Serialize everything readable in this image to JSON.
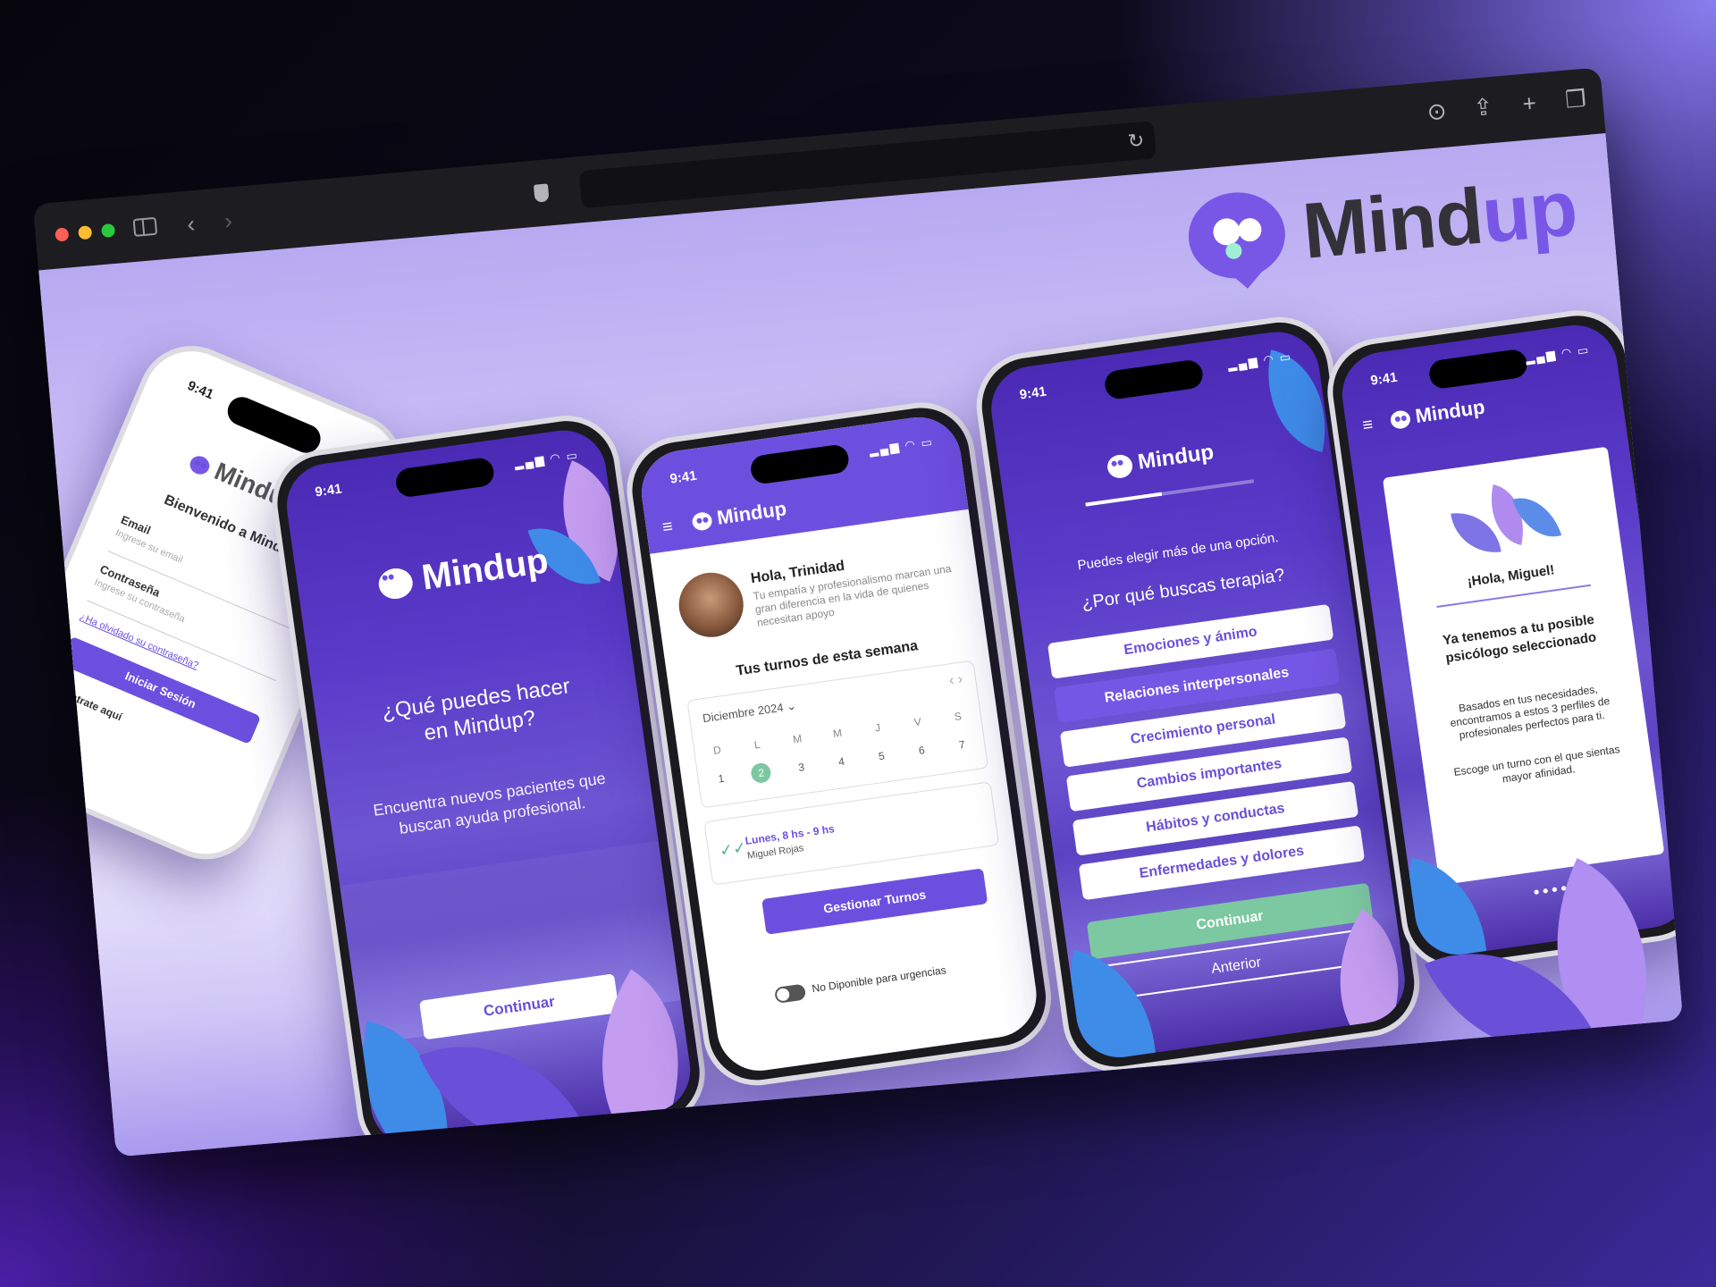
{
  "browser": {
    "back_icon": "chevron-left-icon",
    "forward_icon": "chevron-right-icon",
    "sidebar_icon": "sidebar-icon",
    "privacy_icon": "shield-icon",
    "reload_icon": "reload-icon",
    "download_icon": "download-icon",
    "share_icon": "share-icon",
    "new_tab_icon": "plus-icon",
    "tabs_icon": "tabs-icon"
  },
  "brand": {
    "mind": "Mind",
    "up": "up"
  },
  "colors": {
    "primary": "#7857e6",
    "accent_green": "#7cc8a0",
    "bg_lavender": "#d8cffa"
  },
  "phone_login": {
    "time": "9:41",
    "logo": "Mindup",
    "welcome": "Bienvenido a Mindup",
    "email_label": "Email",
    "email_placeholder": "Ingrese su email",
    "password_label": "Contraseña",
    "password_placeholder": "Ingrese su contraseña",
    "forgot": "¿Ha olvidado su contraseña?",
    "login_button": "Iniciar Sesión",
    "register": "Regístrate aquí"
  },
  "phone_intro": {
    "time": "9:41",
    "logo": "Mindup",
    "heading": "¿Qué puedes hacer en Mindup?",
    "subtitle": "Encuentra nuevos pacientes que buscan ayuda profesional.",
    "continue_button": "Continuar"
  },
  "phone_dashboard": {
    "time": "9:41",
    "logo": "Mindup",
    "greeting": "Hola, Trinidad",
    "message": "Tu empatía y profesionalismo marcan una gran diferencia en la vida de quienes necesitan apoyo",
    "week_title": "Tus turnos de esta semana",
    "month": "Diciembre 2024",
    "weekdays": [
      "D",
      "L",
      "M",
      "M",
      "J",
      "V",
      "S"
    ],
    "days": [
      "1",
      "2",
      "3",
      "4",
      "5",
      "6",
      "7"
    ],
    "appointment_time": "Lunes, 8 hs - 9 hs",
    "appointment_patient": "Miguel Rojas",
    "manage_button": "Gestionar Turnos",
    "toggle_label": "No Diponible para urgencias"
  },
  "phone_questions": {
    "time": "9:41",
    "logo": "Mindup",
    "hint": "Puedes elegir más de una opción.",
    "question": "¿Por qué buscas terapia?",
    "options": [
      "Emociones y ánimo",
      "Relaciones interpersonales",
      "Crecimiento personal",
      "Cambios importantes",
      "Hábitos y conductas",
      "Enfermedades y dolores"
    ],
    "continue_button": "Continuar",
    "previous_button": "Anterior"
  },
  "phone_match": {
    "time": "9:41",
    "logo": "Mindup",
    "greeting": "¡Hola, Miguel!",
    "title": "Ya tenemos a tu posible psicólogo seleccionado",
    "body": "Basados en tus necesidades, encontramos a estos 3 perfiles de profesionales perfectos para ti.",
    "cta": "Escoge un turno con el que sientas mayor afinidad."
  }
}
